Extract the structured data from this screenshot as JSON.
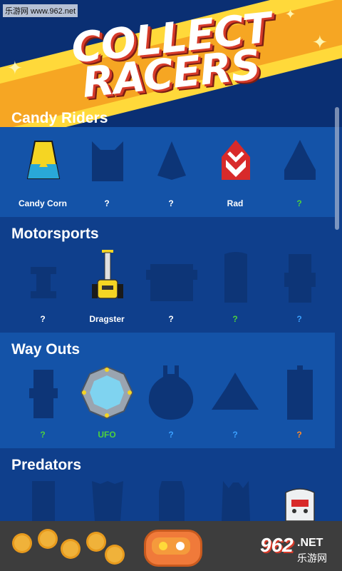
{
  "watermark": "乐游网 www.962.net",
  "title": {
    "line1": "COLLECT",
    "line2": "RACERS"
  },
  "sections": [
    {
      "name": "Candy Riders",
      "items": [
        {
          "label": "Candy Corn",
          "color": "#ffffff",
          "icon": "candy-corn-racer-icon"
        },
        {
          "label": "?",
          "color": "#ffffff",
          "icon": "locked-silhouette-icon"
        },
        {
          "label": "?",
          "color": "#ffffff",
          "icon": "locked-silhouette-icon"
        },
        {
          "label": "Rad",
          "color": "#ffffff",
          "icon": "rad-racer-icon"
        },
        {
          "label": "?",
          "color": "#4ed23c",
          "icon": "locked-silhouette-icon"
        }
      ]
    },
    {
      "name": "Motorsports",
      "items": [
        {
          "label": "?",
          "color": "#ffffff",
          "icon": "locked-silhouette-icon"
        },
        {
          "label": "Dragster",
          "color": "#ffffff",
          "icon": "dragster-racer-icon"
        },
        {
          "label": "?",
          "color": "#ffffff",
          "icon": "locked-silhouette-icon"
        },
        {
          "label": "?",
          "color": "#4ed23c",
          "icon": "locked-silhouette-icon"
        },
        {
          "label": "?",
          "color": "#3aa0ff",
          "icon": "locked-silhouette-icon"
        }
      ]
    },
    {
      "name": "Way Outs",
      "items": [
        {
          "label": "?",
          "color": "#4ed23c",
          "icon": "locked-silhouette-icon"
        },
        {
          "label": "UFO",
          "color": "#4ed23c",
          "icon": "ufo-racer-icon"
        },
        {
          "label": "?",
          "color": "#3aa0ff",
          "icon": "locked-silhouette-icon"
        },
        {
          "label": "?",
          "color": "#3aa0ff",
          "icon": "locked-silhouette-icon"
        },
        {
          "label": "?",
          "color": "#ff8a2a",
          "icon": "locked-silhouette-icon"
        }
      ]
    },
    {
      "name": "Predators",
      "items": [
        {
          "label": "",
          "icon": "locked-silhouette-icon"
        },
        {
          "label": "",
          "icon": "locked-silhouette-icon"
        },
        {
          "label": "",
          "icon": "locked-silhouette-icon"
        },
        {
          "label": "",
          "icon": "locked-silhouette-icon"
        },
        {
          "label": "",
          "icon": "hockey-mask-racer-icon"
        }
      ]
    }
  ],
  "logo": {
    "text1": "962",
    "text2": ".NET",
    "text3": "乐游网"
  }
}
